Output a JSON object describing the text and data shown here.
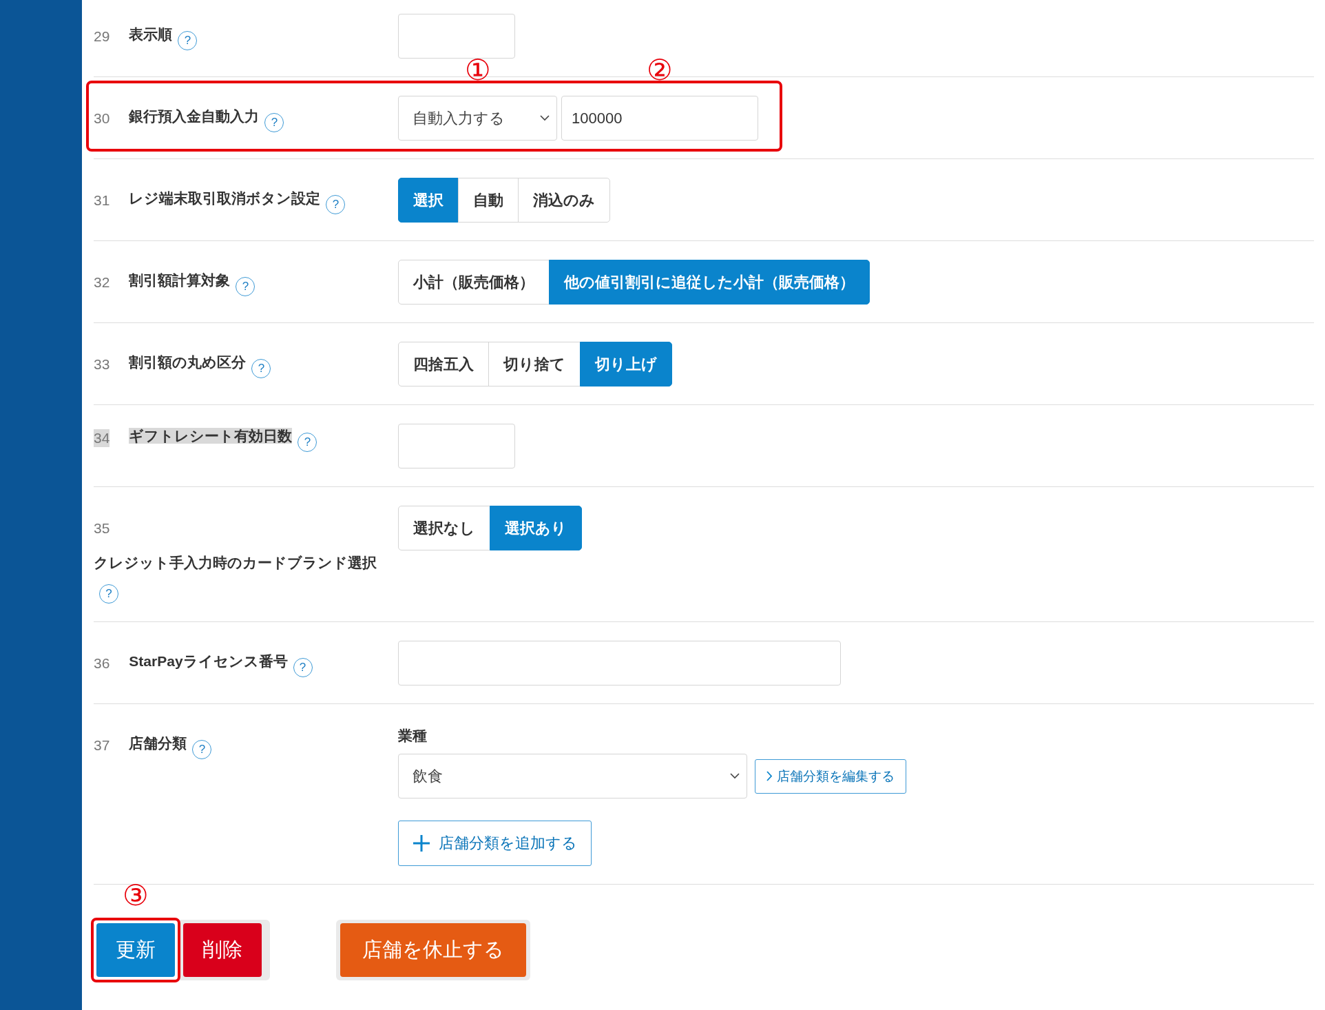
{
  "rows": [
    {
      "number": "29",
      "label": "表示順",
      "help": "?",
      "kind": "text",
      "value": ""
    },
    {
      "number": "30",
      "label": "銀行預入金自動入力",
      "help": "?",
      "kind": "select_text",
      "framed": true,
      "select": {
        "value": "自動入力する",
        "marker": "①"
      },
      "input": {
        "value": "100000",
        "marker": "②"
      }
    },
    {
      "number": "31",
      "label": "レジ端末取引取消ボタン設定",
      "help": "?",
      "kind": "segmented",
      "options": [
        {
          "label": "選択",
          "selected": true
        },
        {
          "label": "自動",
          "selected": false
        },
        {
          "label": "消込のみ",
          "selected": false
        }
      ]
    },
    {
      "number": "32",
      "label": "割引額計算対象",
      "help": "?",
      "kind": "segmented",
      "options": [
        {
          "label": "小計（販売価格）",
          "selected": false
        },
        {
          "label": "他の値引割引に追従した小計（販売価格）",
          "selected": true
        }
      ]
    },
    {
      "number": "33",
      "label": "割引額の丸め区分",
      "help": "?",
      "kind": "segmented",
      "options": [
        {
          "label": "四捨五入",
          "selected": false
        },
        {
          "label": "切り捨て",
          "selected": false
        },
        {
          "label": "切り上げ",
          "selected": true
        }
      ]
    },
    {
      "number": "34",
      "label": "ギフトレシート有効日数",
      "help": "?",
      "kind": "text",
      "text_selected": true,
      "value": ""
    },
    {
      "number": "35",
      "label": "クレジット手入力時のカードブランド選択",
      "help": "?",
      "kind": "segmented",
      "options": [
        {
          "label": "選択なし",
          "selected": false
        },
        {
          "label": "選択あり",
          "selected": true
        }
      ]
    },
    {
      "number": "36",
      "label": "StarPayライセンス番号",
      "help": "?",
      "kind": "wide_text",
      "value": ""
    },
    {
      "number": "37",
      "label": "店舗分類",
      "help": "?",
      "kind": "category",
      "heading": "業種",
      "select": {
        "value": "飲食"
      },
      "edit_link": "店舗分類を編集する",
      "add_button": "店舗分類を追加する"
    }
  ],
  "actions": {
    "primary": [
      {
        "label": "更新",
        "kind": "update",
        "marker": "③",
        "framed": true
      },
      {
        "label": "削除",
        "kind": "delete",
        "framed": false
      }
    ],
    "secondary": {
      "label": "店舗を休止する"
    }
  }
}
